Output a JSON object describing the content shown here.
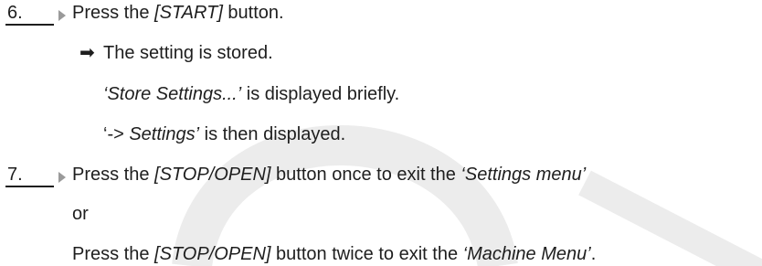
{
  "step6": {
    "number": "6.",
    "text_before": "Press the ",
    "button": "[START]",
    "text_after": " button.",
    "result_arrow": "➡",
    "result_text": "The setting is stored.",
    "line2_quote": "‘Store Settings...’",
    "line2_rest": " is displayed briefly.",
    "line3_quote_prefix": "‘-> ",
    "line3_quote_word": "Settings’",
    "line3_rest": " is then displayed."
  },
  "step7": {
    "number": "7.",
    "text_before": "Press the ",
    "button": "[STOP/OPEN]",
    "text_middle": " button once to exit the ",
    "menu": "‘Settings menu’",
    "or": "or",
    "alt_text_before": "Press the ",
    "alt_button": "[STOP/OPEN]",
    "alt_text_middle": " button twice to exit the ",
    "alt_menu": "‘Machine Menu’",
    "alt_end": "."
  }
}
